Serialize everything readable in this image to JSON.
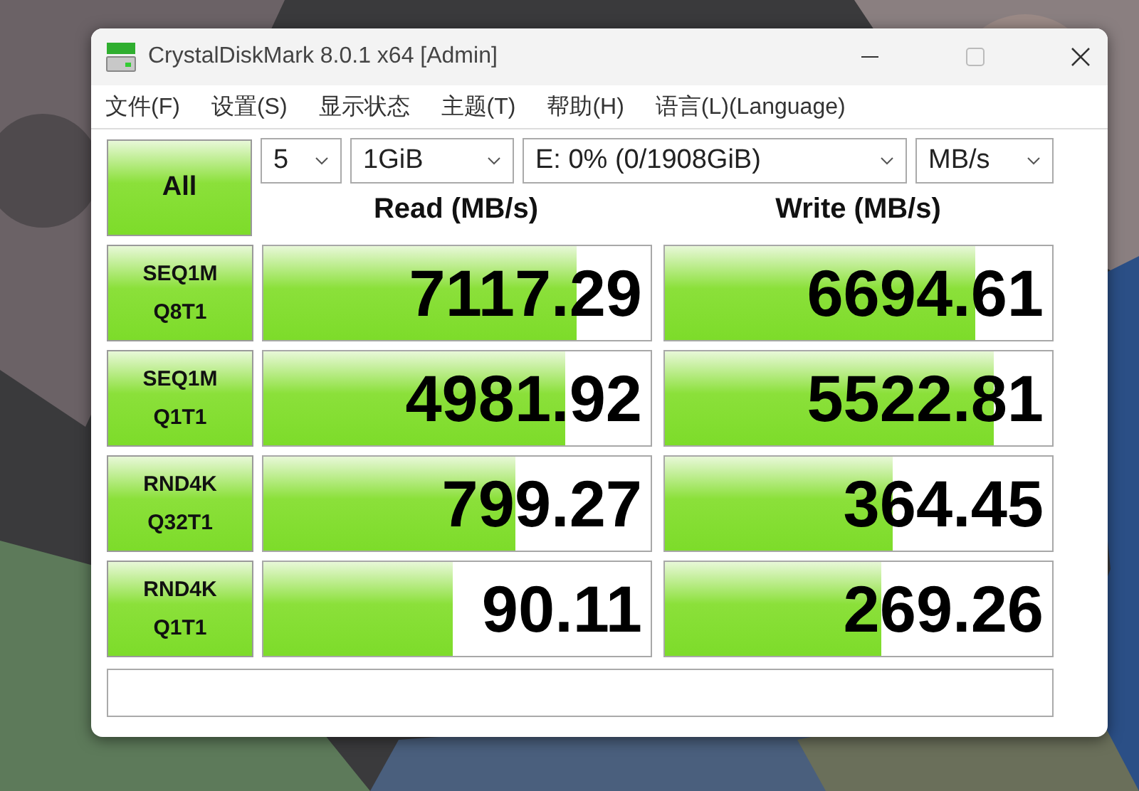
{
  "window": {
    "title": "CrystalDiskMark 8.0.1 x64 [Admin]"
  },
  "menu": [
    "文件(F)",
    "设置(S)",
    "显示状态",
    "主题(T)",
    "帮助(H)",
    "语言(L)(Language)"
  ],
  "all_button": "All",
  "selectors": [
    {
      "value": "5"
    },
    {
      "value": "1GiB"
    },
    {
      "value": "E: 0% (0/1908GiB)"
    },
    {
      "value": "MB/s"
    }
  ],
  "columns": [
    "Read (MB/s)",
    "Write (MB/s)"
  ],
  "rows": [
    {
      "test": "SEQ1M",
      "params": "Q8T1",
      "read": {
        "value": "7117.29",
        "level": 0.81
      },
      "write": {
        "value": "6694.61",
        "level": 0.8
      }
    },
    {
      "test": "SEQ1M",
      "params": "Q1T1",
      "read": {
        "value": "4981.92",
        "level": 0.78
      },
      "write": {
        "value": "5522.81",
        "level": 0.85
      }
    },
    {
      "test": "RND4K",
      "params": "Q32T1",
      "read": {
        "value": "799.27",
        "level": 0.65
      },
      "write": {
        "value": "364.45",
        "level": 0.59
      }
    },
    {
      "test": "RND4K",
      "params": "Q1T1",
      "read": {
        "value": "90.11",
        "level": 0.49
      },
      "write": {
        "value": "269.26",
        "level": 0.56
      }
    }
  ]
}
